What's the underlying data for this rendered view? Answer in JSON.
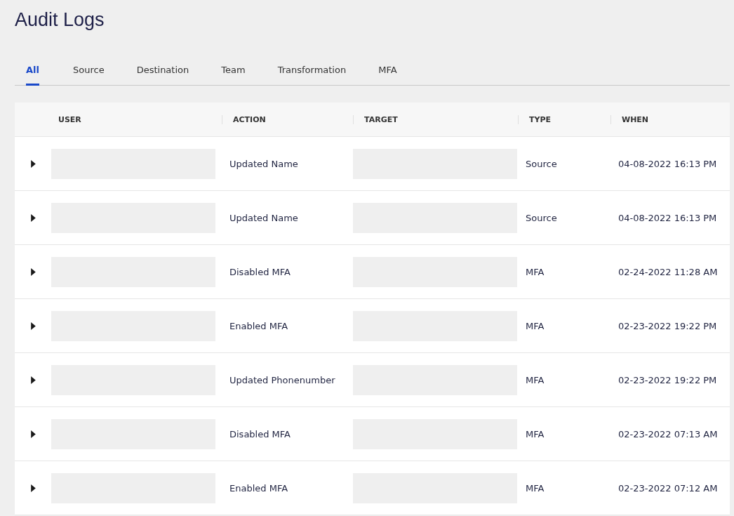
{
  "title": "Audit Logs",
  "tabs": [
    {
      "label": "All",
      "selected": true
    },
    {
      "label": "Source",
      "selected": false
    },
    {
      "label": "Destination",
      "selected": false
    },
    {
      "label": "Team",
      "selected": false
    },
    {
      "label": "Transformation",
      "selected": false
    },
    {
      "label": "MFA",
      "selected": false
    }
  ],
  "table": {
    "columns": [
      "USER",
      "ACTION",
      "TARGET",
      "TYPE",
      "WHEN"
    ],
    "rows": [
      {
        "expanded": false,
        "action": "Updated Name",
        "type": "Source",
        "when": "04-08-2022 16:13 PM"
      },
      {
        "expanded": false,
        "action": "Updated Name",
        "type": "Source",
        "when": "04-08-2022 16:13 PM"
      },
      {
        "expanded": false,
        "action": "Disabled MFA",
        "type": "MFA",
        "when": "02-24-2022 11:28 AM"
      },
      {
        "expanded": false,
        "action": "Enabled MFA",
        "type": "MFA",
        "when": "02-23-2022 19:22 PM"
      },
      {
        "expanded": false,
        "action": "Updated Phonenumber",
        "type": "MFA",
        "when": "02-23-2022 19:22 PM"
      },
      {
        "expanded": false,
        "action": "Disabled MFA",
        "type": "MFA",
        "when": "02-23-2022 07:13 AM"
      },
      {
        "expanded": false,
        "action": "Enabled MFA",
        "type": "MFA",
        "when": "02-23-2022 07:12 AM"
      }
    ]
  }
}
